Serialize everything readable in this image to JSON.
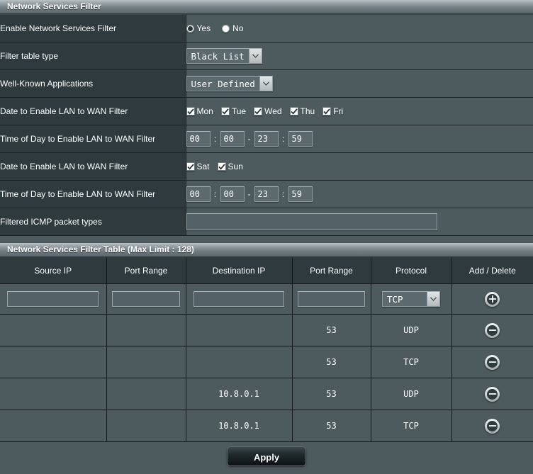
{
  "settings_section": {
    "title": "Network Services Filter",
    "rows": {
      "enable": {
        "label": "Enable Network Services Filter",
        "options": [
          {
            "label": "Yes",
            "selected": true
          },
          {
            "label": "No",
            "selected": false
          }
        ]
      },
      "filter_table_type": {
        "label": "Filter table type",
        "value": "Black List",
        "arrow_icon": "chevron-down-icon"
      },
      "well_known_apps": {
        "label": "Well-Known Applications",
        "value": "User Defined",
        "arrow_icon": "chevron-down-icon"
      },
      "date_weekdays": {
        "label": "Date to Enable LAN to WAN Filter",
        "days": [
          {
            "label": "Mon",
            "checked": true
          },
          {
            "label": "Tue",
            "checked": true
          },
          {
            "label": "Wed",
            "checked": true
          },
          {
            "label": "Thu",
            "checked": true
          },
          {
            "label": "Fri",
            "checked": true
          }
        ]
      },
      "time_weekdays": {
        "label": "Time of Day to Enable LAN to WAN Filter",
        "start_hour": "00",
        "start_min": "00",
        "end_hour": "23",
        "end_min": "59",
        "colon": ":",
        "dash": "-"
      },
      "date_weekend": {
        "label": "Date to Enable LAN to WAN Filter",
        "days": [
          {
            "label": "Sat",
            "checked": true
          },
          {
            "label": "Sun",
            "checked": true
          }
        ]
      },
      "time_weekend": {
        "label": "Time of Day to Enable LAN to WAN Filter",
        "start_hour": "00",
        "start_min": "00",
        "end_hour": "23",
        "end_min": "59",
        "colon": ":",
        "dash": "-"
      },
      "icmp": {
        "label": "Filtered ICMP packet types",
        "value": "",
        "placeholder": ""
      }
    }
  },
  "filter_table_section": {
    "title": "Network Services Filter Table (Max Limit : 128)",
    "columns": [
      "Source IP",
      "Port Range",
      "Destination IP",
      "Port Range",
      "Protocol",
      "Add / Delete"
    ],
    "entry_row": {
      "source_ip": "",
      "source_port": "",
      "dest_ip": "",
      "dest_port": "",
      "protocol": "TCP",
      "protocol_arrow_icon": "chevron-down-icon",
      "action_icon": "plus-circle-icon"
    },
    "rows": [
      {
        "source_ip": "",
        "source_port": "",
        "dest_ip": "",
        "dest_port": "53",
        "protocol": "UDP",
        "action_icon": "minus-circle-icon"
      },
      {
        "source_ip": "",
        "source_port": "",
        "dest_ip": "",
        "dest_port": "53",
        "protocol": "TCP",
        "action_icon": "minus-circle-icon"
      },
      {
        "source_ip": "",
        "source_port": "",
        "dest_ip": "10.8.0.1",
        "dest_port": "53",
        "protocol": "UDP",
        "action_icon": "minus-circle-icon"
      },
      {
        "source_ip": "",
        "source_port": "",
        "dest_ip": "10.8.0.1",
        "dest_port": "53",
        "protocol": "TCP",
        "action_icon": "minus-circle-icon"
      }
    ]
  },
  "footer": {
    "apply_label": "Apply"
  },
  "colors": {
    "page_background": "#4d5a5e",
    "label_cell": "#2f3a3e",
    "title_bar_light": "#b9c0c4",
    "title_bar_dark": "#5b686d",
    "border_dark": "#141a1c",
    "text": "#ffffff"
  }
}
